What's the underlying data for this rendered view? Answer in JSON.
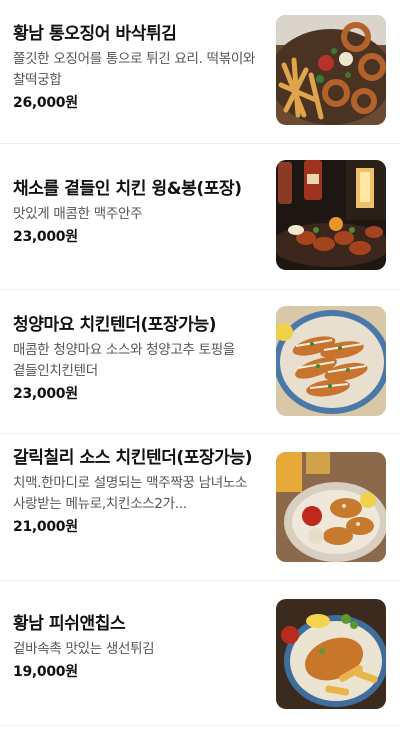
{
  "menu": {
    "items": [
      {
        "name": "황남 통오징어 바삭튀김",
        "desc": "쫄깃한 오징어를 통으로 튀긴 요리. 떡볶이와 찰떡궁합",
        "price": "26,000원",
        "image_icon": "fried-squid-photo"
      },
      {
        "name": "채소를 곁들인 치킨 윙&봉(포장)",
        "desc": "맛있게 매콤한 맥주안주",
        "price": "23,000원",
        "image_icon": "chicken-wings-photo"
      },
      {
        "name": "청양마요 치킨텐더(포장가능)",
        "desc": "매콤한 청양마요 소스와 청양고추 토핑을 곁들인치킨텐더",
        "price": "23,000원",
        "image_icon": "chicken-tender-photo"
      },
      {
        "name": "갈릭칠리 소스 치킨텐더(포장가능)",
        "desc": "치맥.한마디로 설명되는 맥주짝꿍 남녀노소 사랑받는 메뉴로,치킨소스2가...",
        "price": "21,000원",
        "image_icon": "garlic-chili-tender-photo"
      },
      {
        "name": "황남 피쉬앤칩스",
        "desc": "겉바속촉 맛있는 생선튀김",
        "price": "19,000원",
        "image_icon": "fish-and-chips-photo"
      }
    ]
  }
}
